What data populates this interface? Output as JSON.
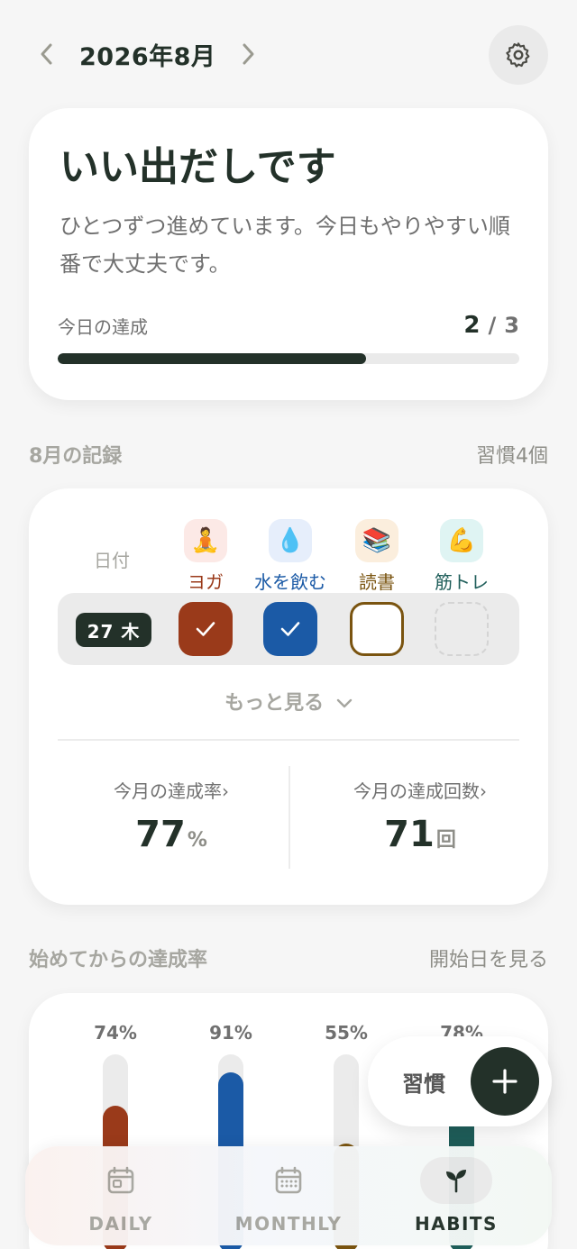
{
  "header": {
    "month": "2026年8月",
    "prev_icon": "chevron-left-icon",
    "next_icon": "chevron-right-icon",
    "settings_icon": "gear-icon"
  },
  "hero": {
    "title": "いい出だしです",
    "message": "ひとつずつ進めています。今日もやりやすい順番で大丈夫です。",
    "progress_label": "今日の達成",
    "done": "2",
    "slash": "/",
    "total": "3",
    "progress_fraction": 0.667
  },
  "record_section": {
    "title": "8月の記録",
    "count": "習慣4個"
  },
  "record": {
    "date_header": "日付",
    "habits": [
      {
        "name": "ヨガ",
        "emoji": "🧘",
        "color": "#9a3a1a",
        "bg": "#fce9e6",
        "status": "done"
      },
      {
        "name": "水を飲む",
        "emoji": "💧",
        "color": "#1b5aa6",
        "bg": "#e6eefb",
        "status": "done"
      },
      {
        "name": "読書",
        "emoji": "📚",
        "color": "#7a5410",
        "bg": "#fbeedd",
        "status": "pending"
      },
      {
        "name": "筋トレ",
        "emoji": "💪",
        "color": "#1f5e5a",
        "bg": "#dff4f3",
        "status": "inactive"
      }
    ],
    "day": "27 木",
    "more": "もっと見る",
    "rate_label": "今月の達成率›",
    "rate_value": "77",
    "rate_unit": "%",
    "count_label": "今月の達成回数›",
    "count_value": "71",
    "count_unit": "回"
  },
  "since_section": {
    "title": "始めてからの達成率",
    "link": "開始日を見る"
  },
  "since_chart": [
    {
      "label": "74%",
      "value": 0.74,
      "color": "#9a3a1a"
    },
    {
      "label": "91%",
      "value": 0.91,
      "color": "#1b5aa6"
    },
    {
      "label": "55%",
      "value": 0.55,
      "color": "#7a5410"
    },
    {
      "label": "78%",
      "value": 0.78,
      "color": "#1f5e5a"
    }
  ],
  "fab": {
    "label": "習慣",
    "icon": "plus-icon"
  },
  "nav": {
    "daily": "DAILY",
    "monthly": "MONTHLY",
    "habits": "HABITS",
    "active": "habits"
  }
}
